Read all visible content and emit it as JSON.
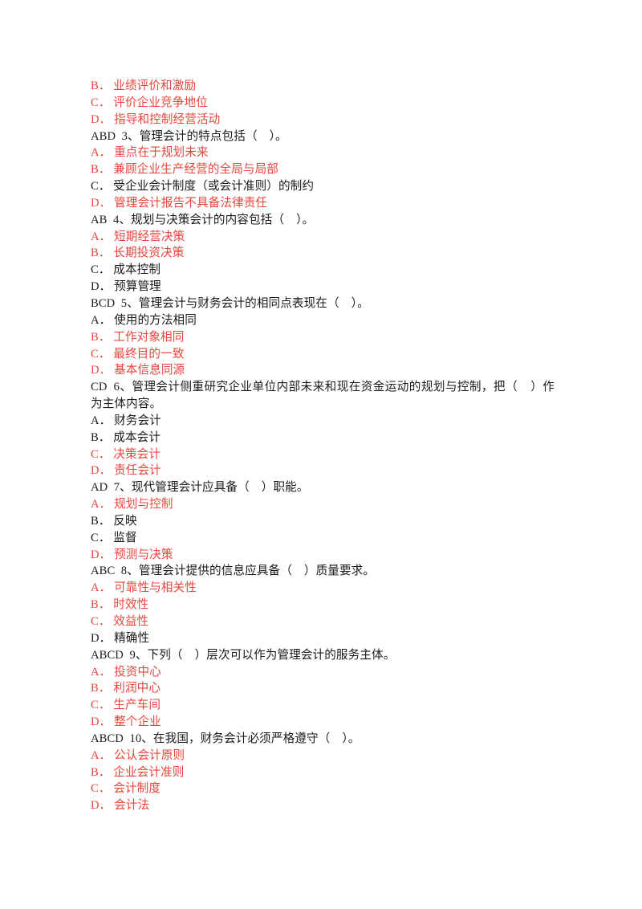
{
  "document": {
    "type": "exam-answer-sheet",
    "language": "zh-CN",
    "colors": {
      "page_background": "#ffffff",
      "body_text": "#1a1a1a",
      "highlight_answer": "#e8453c"
    },
    "continued_options_top": [
      {
        "marker": "B．",
        "text": "业绩评价和激励",
        "highlighted": true
      },
      {
        "marker": "C．",
        "text": "评价企业竞争地位",
        "highlighted": true
      },
      {
        "marker": "D．",
        "text": "指导和控制经营活动",
        "highlighted": true
      }
    ],
    "questions": [
      {
        "answer_key": "ABD",
        "number": "3",
        "stem": "ABD  3、管理会计的特点包括（    ）。",
        "options": [
          {
            "marker": "A．",
            "text": "重点在于规划未来",
            "highlighted": true
          },
          {
            "marker": "B．",
            "text": "兼顾企业生产经营的全局与局部",
            "highlighted": true
          },
          {
            "marker": "C．",
            "text": "受企业会计制度（或会计准则）的制约",
            "highlighted": false
          },
          {
            "marker": "D．",
            "text": "管理会计报告不具备法律责任",
            "highlighted": true
          }
        ]
      },
      {
        "answer_key": "AB",
        "number": "4",
        "stem": "AB  4、规划与决策会计的内容包括（    ）。",
        "options": [
          {
            "marker": "A．",
            "text": "短期经营决策",
            "highlighted": true
          },
          {
            "marker": "B．",
            "text": "长期投资决策",
            "highlighted": true
          },
          {
            "marker": "C．",
            "text": "成本控制",
            "highlighted": false
          },
          {
            "marker": "D．",
            "text": "预算管理",
            "highlighted": false
          }
        ]
      },
      {
        "answer_key": "BCD",
        "number": "5",
        "stem": "BCD  5、管理会计与财务会计的相同点表现在（    ）。",
        "options": [
          {
            "marker": "A．",
            "text": "使用的方法相同",
            "highlighted": false
          },
          {
            "marker": "B．",
            "text": "工作对象相同",
            "highlighted": true
          },
          {
            "marker": "C．",
            "text": "最终目的一致",
            "highlighted": true
          },
          {
            "marker": "D．",
            "text": "基本信息同源",
            "highlighted": true
          }
        ]
      },
      {
        "answer_key": "CD",
        "number": "6",
        "stem": "CD  6、管理会计侧重研究企业单位内部未来和现在资金运动的规划与控制，把（    ）作为主体内容。",
        "options": [
          {
            "marker": "A．",
            "text": "财务会计",
            "highlighted": false
          },
          {
            "marker": "B．",
            "text": "成本会计",
            "highlighted": false
          },
          {
            "marker": "C．",
            "text": "决策会计",
            "highlighted": true
          },
          {
            "marker": "D．",
            "text": "责任会计",
            "highlighted": true
          }
        ]
      },
      {
        "answer_key": "AD",
        "number": "7",
        "stem": "AD  7、现代管理会计应具备（    ）职能。",
        "options": [
          {
            "marker": "A．",
            "text": "规划与控制",
            "highlighted": true
          },
          {
            "marker": "B．",
            "text": "反映",
            "highlighted": false
          },
          {
            "marker": "C．",
            "text": "监督",
            "highlighted": false
          },
          {
            "marker": "D．",
            "text": "预测与决策",
            "highlighted": true
          }
        ]
      },
      {
        "answer_key": "ABC",
        "number": "8",
        "stem": "ABC  8、管理会计提供的信息应具备（    ）质量要求。",
        "options": [
          {
            "marker": "A．",
            "text": "可靠性与相关性",
            "highlighted": true
          },
          {
            "marker": "B．",
            "text": "时效性",
            "highlighted": true
          },
          {
            "marker": "C．",
            "text": "效益性",
            "highlighted": true
          },
          {
            "marker": "D．",
            "text": "精确性",
            "highlighted": false
          }
        ]
      },
      {
        "answer_key": "ABCD",
        "number": "9",
        "stem": "ABCD  9、下列（    ）层次可以作为管理会计的服务主体。",
        "options": [
          {
            "marker": "A．",
            "text": "投资中心",
            "highlighted": true
          },
          {
            "marker": "B．",
            "text": "利润中心",
            "highlighted": true
          },
          {
            "marker": "C．",
            "text": "生产车间",
            "highlighted": true
          },
          {
            "marker": "D．",
            "text": "整个企业",
            "highlighted": true
          }
        ]
      },
      {
        "answer_key": "ABCD",
        "number": "10",
        "stem": "ABCD  10、在我国，财务会计必须严格遵守（    ）。",
        "options": [
          {
            "marker": "A．",
            "text": "公认会计原则",
            "highlighted": true
          },
          {
            "marker": "B．",
            "text": "企业会计准则",
            "highlighted": true
          },
          {
            "marker": "C．",
            "text": "会计制度",
            "highlighted": true
          },
          {
            "marker": "D．",
            "text": "会计法",
            "highlighted": true
          }
        ]
      }
    ]
  }
}
